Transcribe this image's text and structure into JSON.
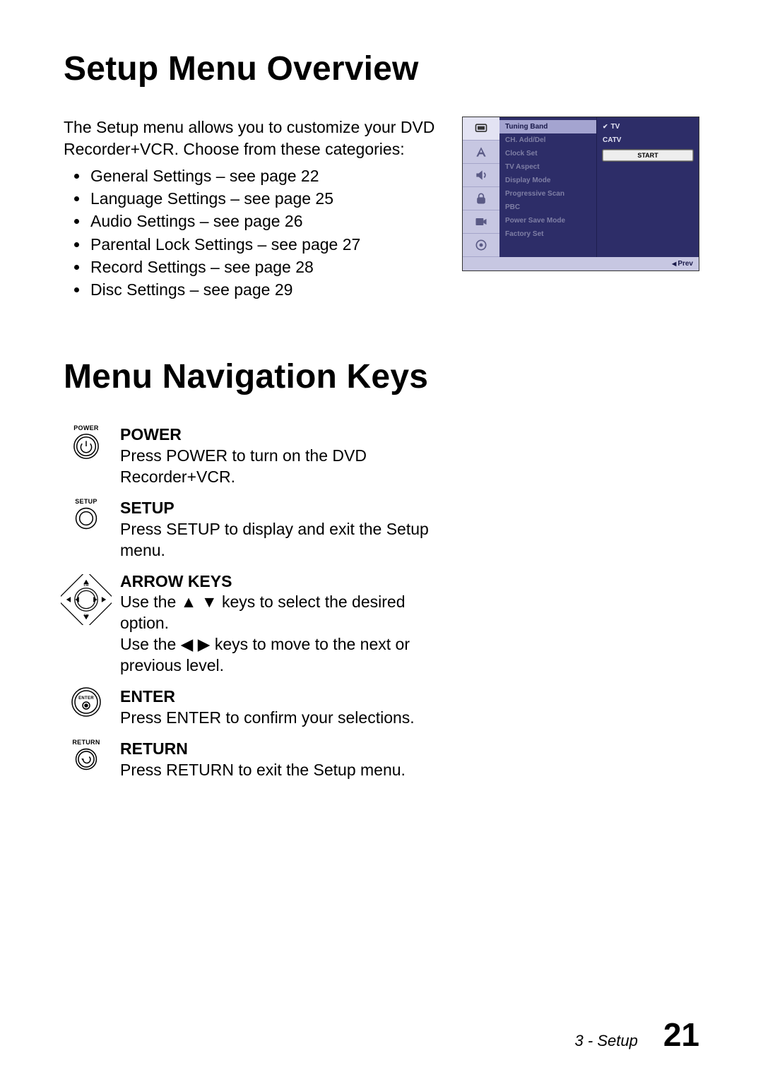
{
  "headings": {
    "setup_overview": "Setup Menu Overview",
    "nav_keys": "Menu Navigation Keys"
  },
  "intro": {
    "text": "The Setup menu allows you to customize your DVD Recorder+VCR. Choose from these categories:",
    "items": [
      "General Settings – see page 22",
      "Language Settings – see page 25",
      "Audio Settings – see page 26",
      "Parental Lock Settings – see page 27",
      "Record Settings – see page 28",
      "Disc Settings – see page 29"
    ]
  },
  "osd": {
    "menu": [
      "Tuning Band",
      "CH. Add/Del",
      "Clock Set",
      "TV Aspect",
      "Display Mode",
      "Progressive Scan",
      "PBC",
      "Power Save Mode",
      "Factory Set"
    ],
    "values": {
      "tv": "TV",
      "catv": "CATV",
      "start": "START"
    },
    "footer": "Prev"
  },
  "keys": {
    "power": {
      "cap": "POWER",
      "title": "POWER",
      "body": "Press POWER to turn on the DVD Recorder+VCR."
    },
    "setup": {
      "cap": "SETUP",
      "title": "SETUP",
      "body": "Press SETUP to display and exit the Setup menu."
    },
    "arrows": {
      "title": "ARROW KEYS",
      "body1a": "Use the ",
      "body1b": " keys to select the desired option.",
      "body2a": "Use the ",
      "body2b": " keys to move to the next or previous level."
    },
    "enter": {
      "cap": "ENTER",
      "title": "ENTER",
      "body": "Press ENTER to confirm your selections."
    },
    "return": {
      "cap": "RETURN",
      "title": "RETURN",
      "body": "Press RETURN to exit the Setup menu."
    }
  },
  "footer": {
    "chapter": "3 - Setup",
    "page": "21"
  }
}
